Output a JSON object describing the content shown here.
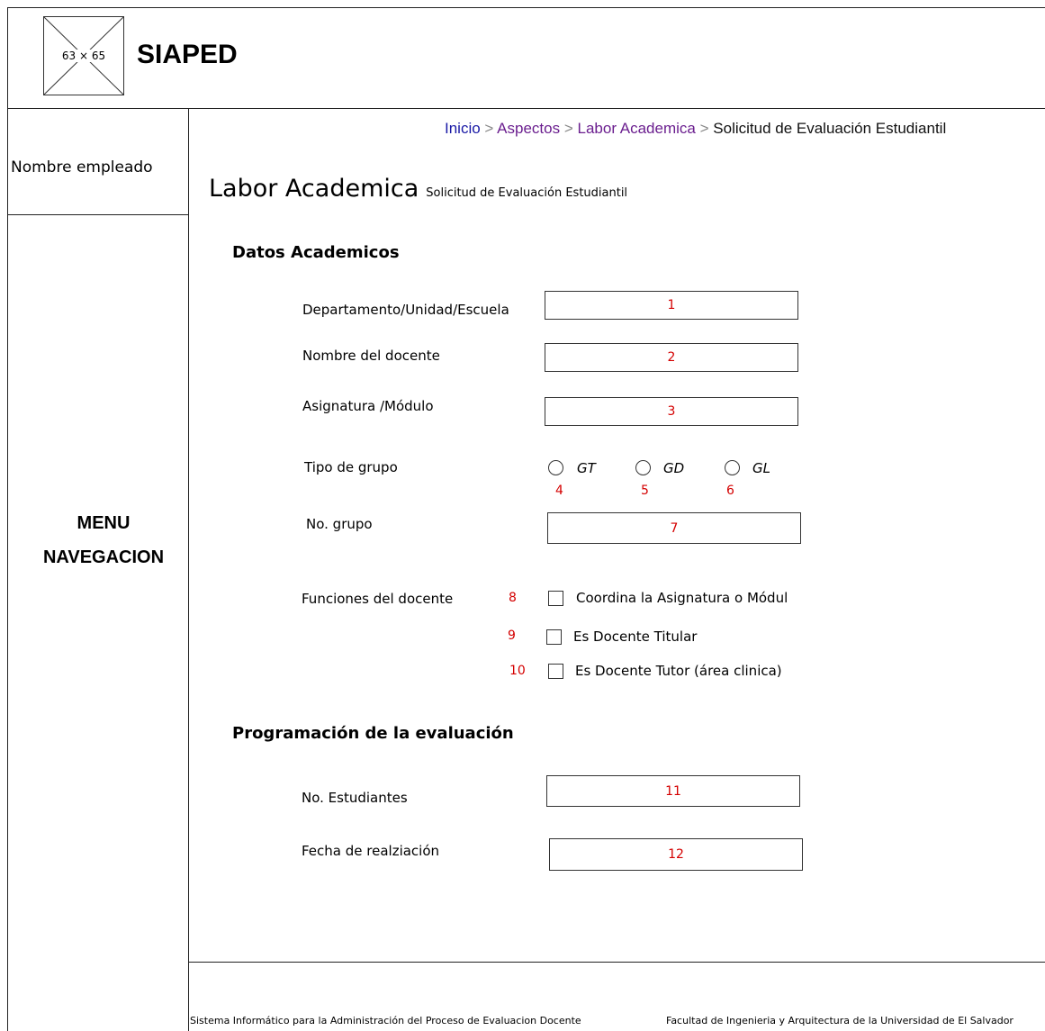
{
  "header": {
    "logo_placeholder": "63 × 65",
    "app_title": "SIAPED"
  },
  "sidebar": {
    "employee_name": "Nombre empleado",
    "menu_line1": "MENU",
    "menu_line2": "NAVEGACION"
  },
  "breadcrumb": {
    "items": [
      "Inicio",
      "Aspectos",
      "Labor Academica"
    ],
    "separator": ">",
    "current": "Solicitud de Evaluación Estudiantil"
  },
  "page": {
    "title": "Labor Academica",
    "subtitle": "Solicitud de Evaluación Estudiantil"
  },
  "datos_academicos": {
    "section_title": "Datos Academicos",
    "departamento_label": "Departamento/Unidad/Escuela",
    "departamento_value": "1",
    "docente_label": "Nombre del docente",
    "docente_value": "2",
    "asignatura_label": "Asignatura /Módulo",
    "asignatura_value": "3",
    "tipo_grupo_label": "Tipo de grupo",
    "tipo_grupo_options": [
      {
        "label": "GT",
        "marker": "4"
      },
      {
        "label": "GD",
        "marker": "5"
      },
      {
        "label": "GL",
        "marker": "6"
      }
    ],
    "no_grupo_label": "No. grupo",
    "no_grupo_value": "7",
    "funciones_label": "Funciones del docente",
    "funciones": [
      {
        "marker": "8",
        "label": "Coordina la Asignatura o Módul"
      },
      {
        "marker": "9",
        "label": "Es Docente Titular"
      },
      {
        "marker": "10",
        "label": "Es Docente Tutor (área clinica)"
      }
    ]
  },
  "programacion": {
    "section_title": "Programación de la evaluación",
    "no_estudiantes_label": "No. Estudiantes",
    "no_estudiantes_value": "11",
    "fecha_label": "Fecha de realziación",
    "fecha_value": "12"
  },
  "footer": {
    "left_text": "Sistema Informático para la Administración del Proceso de Evaluacion Docente",
    "right_text": "Facultad de Ingenieria y Arquitectura de la Universidad de El Salvador"
  }
}
